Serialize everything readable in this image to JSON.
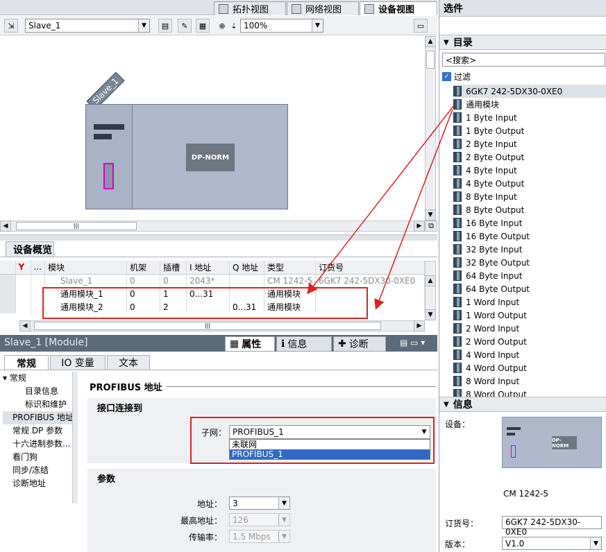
{
  "view_tabs": [
    {
      "label": "拓扑视图",
      "icon": "topology-view-icon"
    },
    {
      "label": "网络视图",
      "icon": "network-view-icon"
    },
    {
      "label": "设备视图",
      "icon": "device-view-icon",
      "active": true
    }
  ],
  "toolbar": {
    "device_select": "Slave_1",
    "zoom": "100%"
  },
  "canvas": {
    "rack_name": "Slave_1",
    "module_label": "DP-NORM"
  },
  "overview": {
    "tab_label": "设备概览",
    "columns": [
      "",
      "...",
      "模块",
      "机架",
      "插槽",
      "I 地址",
      "Q 地址",
      "类型",
      "订货号"
    ],
    "rows": [
      {
        "module": "Slave_1",
        "rack": "0",
        "slot": "0",
        "i_addr": "2043*",
        "q_addr": "",
        "type": "CM 1242-5",
        "order": "6GK7 242-5DX30-0XE0"
      },
      {
        "module": "通用模块_1",
        "rack": "0",
        "slot": "1",
        "i_addr": "0...31",
        "q_addr": "",
        "type": "通用模块",
        "order": ""
      },
      {
        "module": "通用模块_2",
        "rack": "0",
        "slot": "2",
        "i_addr": "",
        "q_addr": "0...31",
        "type": "通用模块",
        "order": ""
      }
    ]
  },
  "properties": {
    "title": "Slave_1 [Module]",
    "tabs": [
      "属性",
      "信息",
      "诊断"
    ],
    "subtabs": [
      "常规",
      "IO 变量",
      "文本"
    ],
    "tree": [
      {
        "label": "常规",
        "level": 0
      },
      {
        "label": "目录信息",
        "level": 1
      },
      {
        "label": "标识和维护",
        "level": 1
      },
      {
        "label": "PROFIBUS 地址",
        "level": 0
      },
      {
        "label": "常规 DP 参数",
        "level": 0
      },
      {
        "label": "十六进制参数...",
        "level": 0
      },
      {
        "label": "看门狗",
        "level": 0
      },
      {
        "label": "同步/冻结",
        "level": 0
      },
      {
        "label": "诊断地址",
        "level": 0
      }
    ],
    "section_title": "PROFIBUS 地址",
    "interface_group": "接口连接到",
    "subnet_label": "子网：",
    "subnet_value": "PROFIBUS_1",
    "subnet_options": [
      "未联网",
      "PROFIBUS_1"
    ],
    "params_group": "参数",
    "address_label": "地址：",
    "address_value": "3",
    "max_address_label": "最高地址：",
    "max_address_value": "126",
    "baud_label": "传输率：",
    "baud_value": "1.5 Mbps"
  },
  "catalog": {
    "pane_title": "选件",
    "section_title": "目录",
    "search_placeholder": "<搜索>",
    "filter_label": "过滤",
    "items": [
      "6GK7 242-5DX30-0XE0",
      "通用模块",
      "1 Byte Input",
      "1 Byte Output",
      "2 Byte Input",
      "2 Byte Output",
      "4 Byte Input",
      "4 Byte Output",
      "8 Byte Input",
      "8 Byte Output",
      "16 Byte Input",
      "16 Byte Output",
      "32 Byte Input",
      "32 Byte Output",
      "64 Byte Input",
      "64 Byte Output",
      "1 Word Input",
      "1 Word Output",
      "2 Word Input",
      "2 Word Output",
      "4 Word Input",
      "4 Word Output",
      "8 Word Input",
      "8 Word Output"
    ]
  },
  "info_panel": {
    "title": "信息",
    "device_label": "设备：",
    "thumb_label": "DP-NORM",
    "device_name": "CM 1242-5",
    "order_label": "订货号：",
    "order_value": "6GK7 242-5DX30-0XE0",
    "version_label": "版本：",
    "version_value": "V1.0"
  }
}
